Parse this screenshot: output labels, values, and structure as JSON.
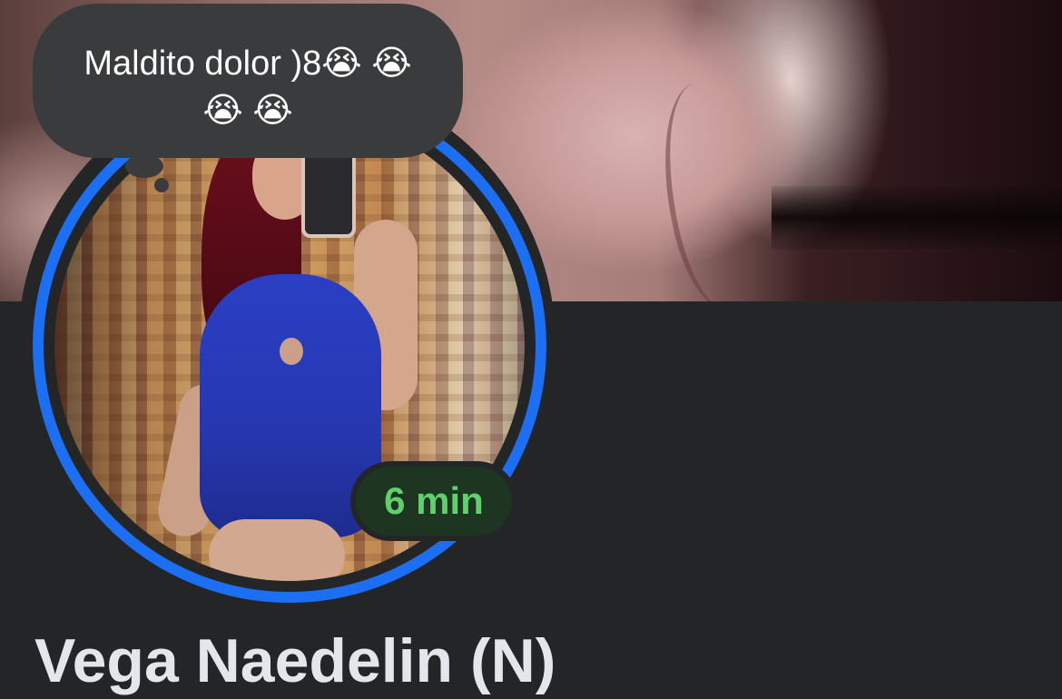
{
  "note": {
    "text": "Maldito dolor )8",
    "emojis": [
      "😭",
      "😭",
      "😭",
      "😭"
    ],
    "emoji_name": "loudly-crying-face"
  },
  "status": {
    "active_time": "6 min",
    "color": "#5fd16c"
  },
  "profile": {
    "name": "Vega Naedelin (N)",
    "story_ring_color": "#1c6ef2"
  },
  "colors": {
    "background": "#242526",
    "bubble": "#3a3b3c"
  }
}
